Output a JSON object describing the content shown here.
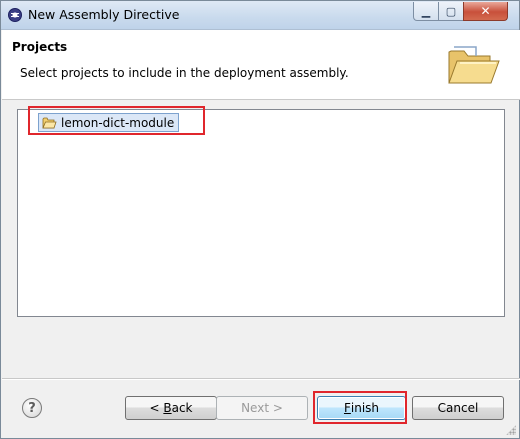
{
  "window": {
    "title": "New Assembly Directive",
    "controls": {
      "minimize": "▁",
      "maximize": "▢",
      "close": "✕"
    }
  },
  "header": {
    "title": "Projects",
    "description": "Select projects to include in the deployment assembly.",
    "icon": "open-folder-banner-icon"
  },
  "projects": {
    "items": [
      {
        "label": "lemon-dict-module",
        "icon": "project-folder-icon",
        "selected": true
      }
    ]
  },
  "footer": {
    "help_label": "?",
    "back_label": {
      "prefix": "< ",
      "mnemonic": "B",
      "rest": "ack"
    },
    "next_label": "Next >",
    "finish_label": {
      "mnemonic": "F",
      "rest": "inish"
    },
    "cancel_label": "Cancel"
  },
  "colors": {
    "highlight": "#e0262c",
    "selection": "#dbe7f7",
    "default_button": "#bee6fd"
  }
}
